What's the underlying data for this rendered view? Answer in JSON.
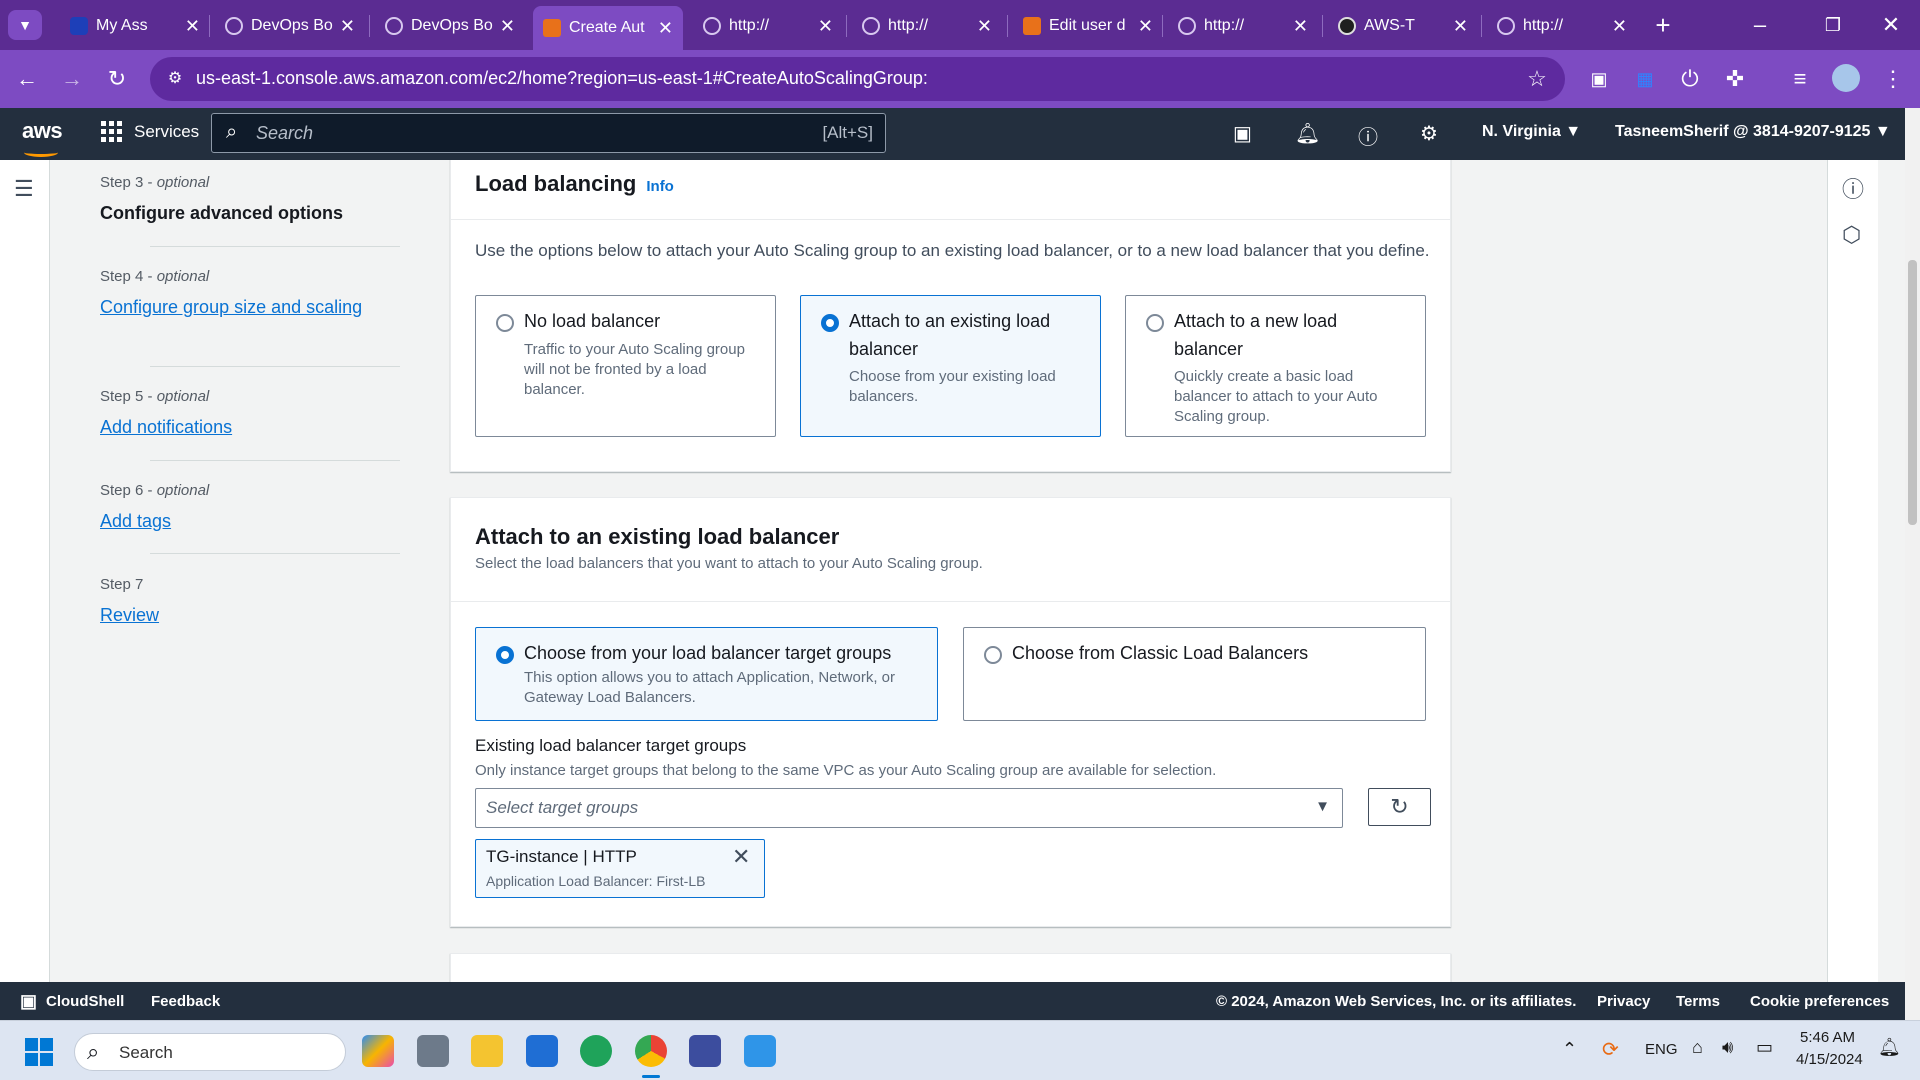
{
  "browser": {
    "tabs": [
      {
        "title": "My Ass",
        "active": false
      },
      {
        "title": "DevOps Bo",
        "active": false
      },
      {
        "title": "DevOps Bo",
        "active": false
      },
      {
        "title": "Create Aut",
        "active": true
      },
      {
        "title": "http://",
        "active": false
      },
      {
        "title": "http://",
        "active": false
      },
      {
        "title": "Edit user d",
        "active": false
      },
      {
        "title": "http://",
        "active": false
      },
      {
        "title": "AWS-T",
        "active": false
      },
      {
        "title": "http://",
        "active": false
      }
    ],
    "url": "us-east-1.console.aws.amazon.com/ec2/home?region=us-east-1#CreateAutoScalingGroup:"
  },
  "aws_header": {
    "logo": "aws",
    "services_label": "Services",
    "search_placeholder": "Search",
    "search_shortcut": "[Alt+S]",
    "region": "N. Virginia ▼",
    "account": "TasneemSherif @ 3814-9207-9125 ▼"
  },
  "steps": [
    {
      "step": "Step 3",
      "optional": "optional",
      "name": "Configure advanced options",
      "current": true
    },
    {
      "step": "Step 4",
      "optional": "optional",
      "name": "Configure group size and scaling",
      "current": false
    },
    {
      "step": "Step 5",
      "optional": "optional",
      "name": "Add notifications",
      "current": false
    },
    {
      "step": "Step 6",
      "optional": "optional",
      "name": "Add tags",
      "current": false
    },
    {
      "step": "Step 7",
      "optional": "",
      "name": "Review",
      "current": false
    }
  ],
  "load_balancing": {
    "title": "Load balancing",
    "info": "Info",
    "description": "Use the options below to attach your Auto Scaling group to an existing load balancer, or to a new load balancer that you define.",
    "options": [
      {
        "title": "No load balancer",
        "desc": "Traffic to your Auto Scaling group will not be fronted by a load balancer.",
        "selected": false
      },
      {
        "title": "Attach to an existing load balancer",
        "desc": "Choose from your existing load balancers.",
        "selected": true
      },
      {
        "title": "Attach to a new load balancer",
        "desc": "Quickly create a basic load balancer to attach to your Auto Scaling group.",
        "selected": false
      }
    ]
  },
  "attach_existing": {
    "title": "Attach to an existing load balancer",
    "description": "Select the load balancers that you want to attach to your Auto Scaling group.",
    "options": [
      {
        "title": "Choose from your load balancer target groups",
        "desc": "This option allows you to attach Application, Network, or Gateway Load Balancers.",
        "selected": true
      },
      {
        "title": "Choose from Classic Load Balancers",
        "desc": "",
        "selected": false
      }
    ],
    "target_groups_label": "Existing load balancer target groups",
    "target_groups_hint": "Only instance target groups that belong to the same VPC as your Auto Scaling group are available for selection.",
    "select_placeholder": "Select target groups",
    "token": {
      "title": "TG-instance | HTTP",
      "sub": "Application Load Balancer: First-LB"
    }
  },
  "footer": {
    "cloudshell": "CloudShell",
    "feedback": "Feedback",
    "copyright": "© 2024, Amazon Web Services, Inc. or its affiliates.",
    "privacy": "Privacy",
    "terms": "Terms",
    "cookies": "Cookie preferences"
  },
  "taskbar": {
    "search_placeholder": "Search",
    "language": "ENG",
    "time": "5:46 AM",
    "date": "4/15/2024"
  },
  "colors": {
    "tab_strip": "#5b2c92",
    "toolbar": "#7d4bc2",
    "aws_nav": "#232f3e",
    "link": "#0972d3",
    "aws_orange": "#ff9900"
  },
  "icons": [
    "tab-search-icon",
    "back-icon",
    "forward-icon",
    "reload-icon",
    "site-info-icon",
    "bookmark-star-icon",
    "services-grid-icon",
    "search-icon",
    "cloudshell-icon",
    "bell-icon",
    "help-icon",
    "settings-icon",
    "menu-icon",
    "info-circle-icon",
    "feedback-hexagon-icon",
    "refresh-icon",
    "close-x-icon",
    "windows-start-icon",
    "wifi-icon",
    "volume-icon",
    "battery-icon"
  ]
}
